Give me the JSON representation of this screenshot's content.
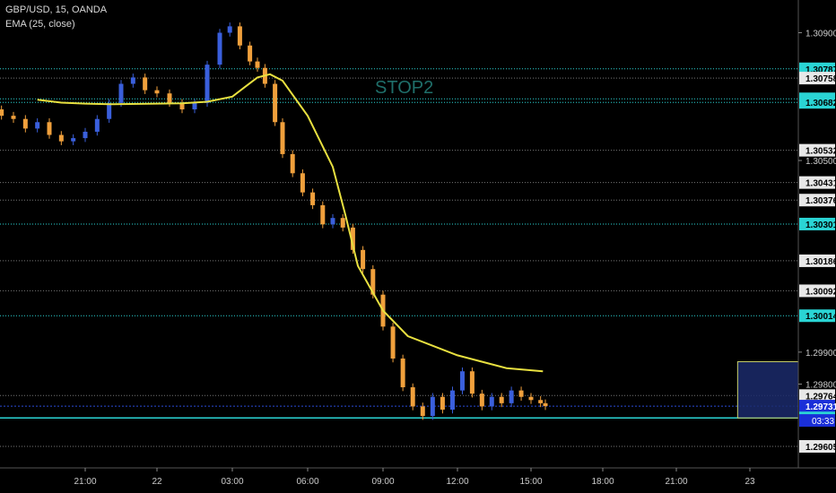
{
  "header": {
    "symbol_line": "GBP/USD, 15, OANDA",
    "indicator_line": "EMA (25, close)"
  },
  "annotation_text": "STOP2",
  "colors": {
    "background": "#000000",
    "bull": "#3a5fdc",
    "bear": "#f0a03c",
    "ema": "#e8e040",
    "level_line": "#2ad4d4",
    "dotted_line": "#777777",
    "box_fill": "#1b2a6b",
    "box_border": "#c8d06a"
  },
  "chart_data": {
    "type": "candlestick",
    "title": "GBP/USD, 15, OANDA",
    "series": [
      {
        "name": "EMA (25, close)",
        "values_note": "approx",
        "values": [
          1.3069,
          1.30681,
          1.30678,
          1.30676,
          1.30679,
          1.30684,
          1.307,
          1.3073,
          1.3076,
          1.3077,
          1.3075,
          1.3064,
          1.3048,
          1.3033,
          1.3017,
          1.3003,
          1.2995,
          1.2989,
          1.2985,
          1.2984
        ]
      }
    ],
    "ema_x": [
      "19:00",
      "20:00",
      "21:00",
      "22:00",
      "01:00",
      "02:00",
      "03:00",
      "03:30",
      "04:00",
      "04:30",
      "05:00",
      "06:00",
      "07:00",
      "07:30",
      "08:00",
      "09:00",
      "10:00",
      "12:00",
      "14:00",
      "15:30"
    ],
    "x_ticks": [
      "21:00",
      "22",
      "03:00",
      "06:00",
      "09:00",
      "12:00",
      "15:00",
      "18:00",
      "21:00",
      "23"
    ],
    "y_ticks": [
      "1.30900",
      "1.30500",
      "1.29900",
      "1.29800"
    ],
    "ylim": [
      1.2956,
      1.3098
    ],
    "horizontal_levels": [
      {
        "price": 1.30787,
        "label": "1.30787",
        "style": "level"
      },
      {
        "price": 1.30758,
        "label": "1.30758",
        "style": "dotted"
      },
      {
        "price": 1.30693,
        "label": "1.30693",
        "style": "level"
      },
      {
        "price": 1.30682,
        "label": "1.30682",
        "style": "level"
      },
      {
        "price": 1.30532,
        "label": "1.30532",
        "style": "dotted"
      },
      {
        "price": 1.30431,
        "label": "1.30431",
        "style": "dotted"
      },
      {
        "price": 1.30376,
        "label": "1.30376",
        "style": "dotted"
      },
      {
        "price": 1.30301,
        "label": "1.30301",
        "style": "level"
      },
      {
        "price": 1.30186,
        "label": "1.30186",
        "style": "dotted"
      },
      {
        "price": 1.30092,
        "label": "1.30092",
        "style": "dotted"
      },
      {
        "price": 1.30014,
        "label": "1.30014",
        "style": "level"
      },
      {
        "price": 1.29764,
        "label": "1.29764",
        "style": "dotted"
      },
      {
        "price": 1.29731,
        "label": "1.29731",
        "style": "current"
      },
      {
        "price": 1.29694,
        "label": "1.29694",
        "style": "level"
      },
      {
        "price": 1.29605,
        "label": "1.29605",
        "style": "dotted"
      }
    ],
    "countdown": "03:33",
    "rectangle": {
      "price_top": 1.2987,
      "price_bottom": 1.29694,
      "time_start": "11:30",
      "time_end": "15:15"
    }
  }
}
